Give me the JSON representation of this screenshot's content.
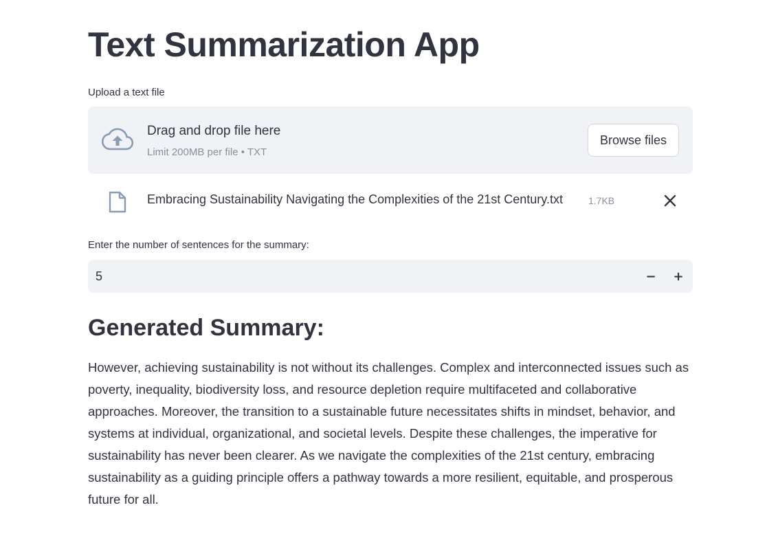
{
  "app": {
    "title": "Text Summarization App"
  },
  "uploader": {
    "label": "Upload a text file",
    "drop_title": "Drag and drop file here",
    "drop_limit": "Limit 200MB per file • TXT",
    "browse_label": "Browse files",
    "file": {
      "name": "Embracing Sustainability Navigating the Complexities of the 21st Century.txt",
      "size": "1.7KB"
    }
  },
  "number_input": {
    "label": "Enter the number of sentences for the summary:",
    "value": "5",
    "minus": "−",
    "plus": "+"
  },
  "summary": {
    "heading": "Generated Summary:",
    "text": "However, achieving sustainability is not without its challenges. Complex and interconnected issues such as poverty, inequality, biodiversity loss, and resource depletion require multifaceted and collaborative approaches. Moreover, the transition to a sustainable future necessitates shifts in mindset, behavior, and systems at individual, organizational, and societal levels. Despite these challenges, the imperative for sustainability has never been clearer. As we navigate the complexities of the 21st century, embracing sustainability as a guiding principle offers a pathway towards a more resilient, equitable, and prosperous future for all."
  },
  "icons": {
    "upload": "cloud-upload-icon",
    "file": "file-icon",
    "remove": "close-icon"
  },
  "colors": {
    "text": "#31333f",
    "muted": "#8b8f99",
    "panel": "#f0f2f6",
    "icon": "#8a9bb4"
  }
}
